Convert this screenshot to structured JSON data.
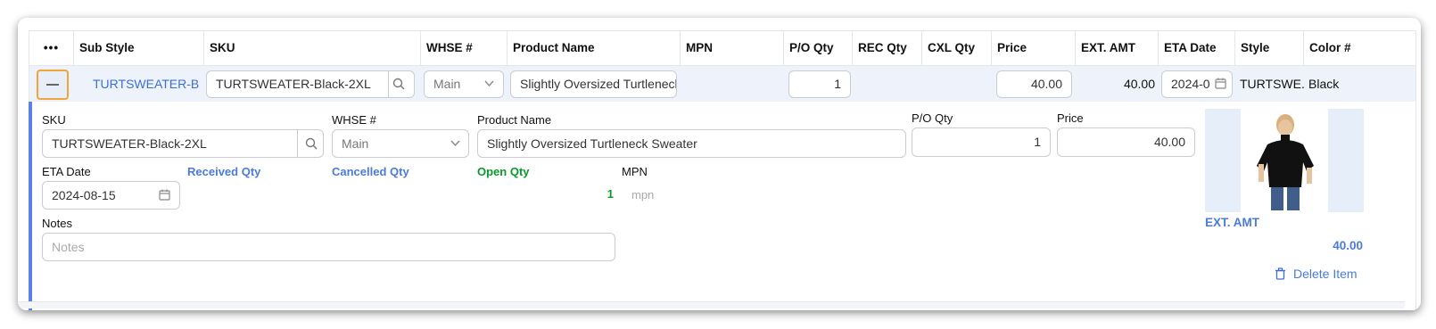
{
  "header": {
    "menu_icon": "ellipsis-icon",
    "columns": [
      "Sub Style",
      "SKU",
      "WHSE #",
      "Product Name",
      "MPN",
      "P/O Qty",
      "REC Qty",
      "CXL Qty",
      "Price",
      "EXT. AMT",
      "ETA Date",
      "Style",
      "Color #"
    ]
  },
  "row": {
    "sub_style": "TURTSWEATER-Blac",
    "sku": "TURTSWEATER-Black-2XL",
    "whse": "Main",
    "product_name": "Slightly Oversized Turtleneck Sweater",
    "po_qty": "1",
    "price": "40.00",
    "ext_amt": "40.00",
    "eta_date": "2024-0",
    "style": "TURTSWE...",
    "color": "Black"
  },
  "detail": {
    "sku_label": "SKU",
    "sku_value": "TURTSWEATER-Black-2XL",
    "whse_label": "WHSE #",
    "whse_value": "Main",
    "product_name_label": "Product Name",
    "product_name_value": "Slightly Oversized Turtleneck Sweater",
    "po_qty_label": "P/O Qty",
    "po_qty_value": "1",
    "price_label": "Price",
    "price_value": "40.00",
    "eta_date_label": "ETA Date",
    "eta_date_value": "2024-08-15",
    "received_qty_label": "Received Qty",
    "cancelled_qty_label": "Cancelled Qty",
    "open_qty_label": "Open Qty",
    "open_qty_value": "1",
    "mpn_label": "MPN",
    "mpn_value": "mpn",
    "notes_label": "Notes",
    "notes_placeholder": "Notes",
    "ext_amt_label": "EXT. AMT",
    "ext_amt_value": "40.00",
    "delete_label": "Delete Item"
  },
  "colors": {
    "accent": "#3b6fd6",
    "focus": "#f0a43a",
    "green": "#0a9a2a",
    "row_bg": "#eef3fb"
  }
}
